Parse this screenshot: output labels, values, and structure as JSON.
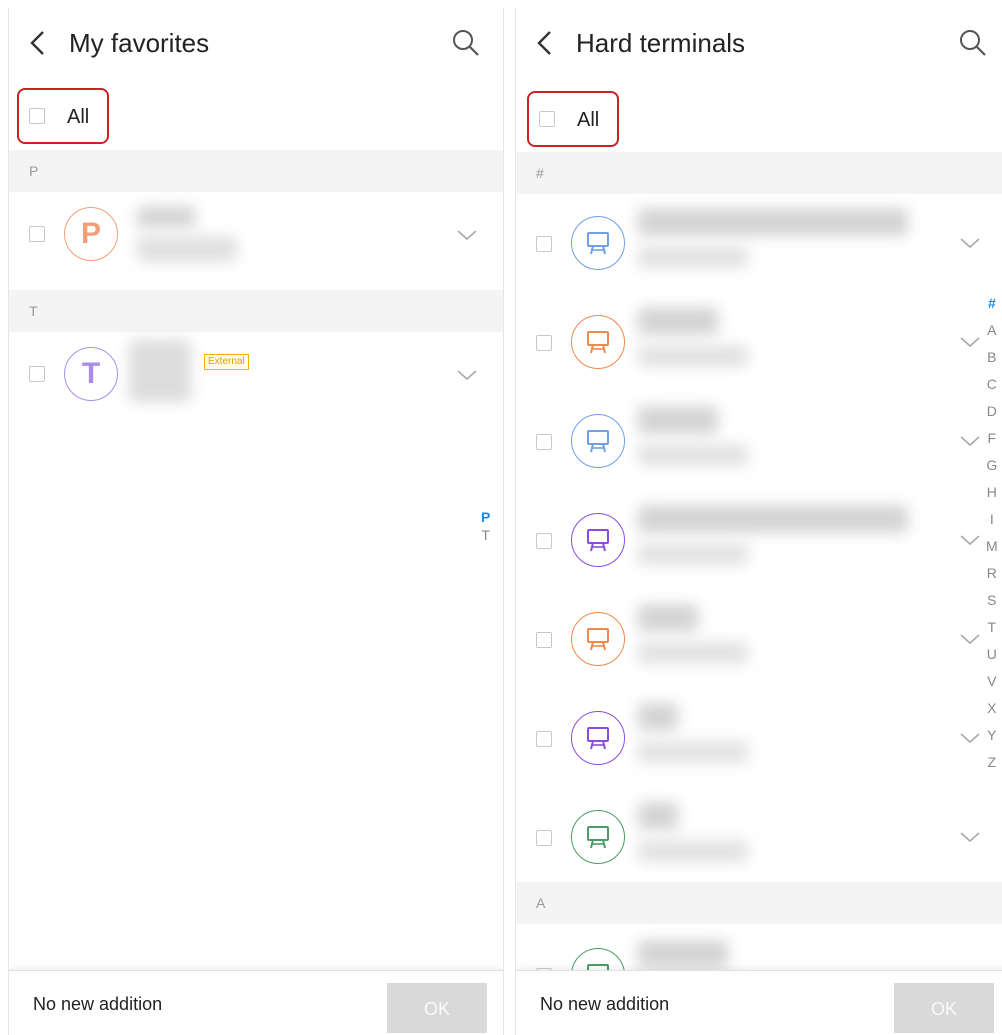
{
  "left": {
    "title": "My favorites",
    "all_label": "All",
    "sections": [
      {
        "letter": "P",
        "avatar_letter": "P",
        "color": "#f0a078"
      },
      {
        "letter": "T",
        "avatar_letter": "T",
        "color": "#a98ee8",
        "badge": "External"
      }
    ],
    "index": [
      "P",
      "T"
    ],
    "footer_text": "No new addition",
    "ok_label": "OK"
  },
  "right": {
    "title": "Hard terminals",
    "all_label": "All",
    "section_hash": "#",
    "section_a": "A",
    "terminal_colors": [
      "#6f9fe8",
      "#ef8a4c",
      "#6f9fe8",
      "#8a4de0",
      "#ef8a4c",
      "#8a4de0",
      "#4a9e65",
      "#4a9e65"
    ],
    "index": [
      "#",
      "A",
      "B",
      "C",
      "D",
      "F",
      "G",
      "H",
      "I",
      "M",
      "R",
      "S",
      "T",
      "U",
      "V",
      "X",
      "Y",
      "Z"
    ],
    "footer_text": "No new addition",
    "ok_label": "OK"
  },
  "colors": {
    "highlight_border": "#cc2222",
    "index_active": "#1e88e5",
    "badge": "#e6a100"
  }
}
